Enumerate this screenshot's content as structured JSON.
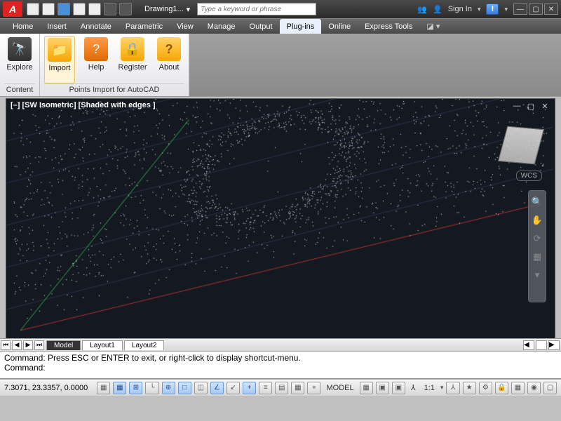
{
  "titlebar": {
    "doc_name": "Drawing1...",
    "search_placeholder": "Type a keyword or phrase",
    "signin": "Sign In"
  },
  "menu": {
    "items": [
      "Home",
      "Insert",
      "Annotate",
      "Parametric",
      "View",
      "Manage",
      "Output",
      "Plug-ins",
      "Online",
      "Express Tools"
    ],
    "active_index": 7
  },
  "ribbon": {
    "panels": [
      {
        "name": "Content",
        "buttons": [
          {
            "label": "Explore",
            "icon": "binoc"
          }
        ]
      },
      {
        "name": "Points Import for AutoCAD",
        "buttons": [
          {
            "label": "Import",
            "icon": "folder",
            "selected": true
          },
          {
            "label": "Help",
            "icon": "helpq"
          },
          {
            "label": "Register",
            "icon": "lock"
          },
          {
            "label": "About",
            "icon": "about"
          }
        ]
      }
    ]
  },
  "viewport": {
    "title": "[–] [SW Isometric] [Shaded with edges ]",
    "wcs": "WCS"
  },
  "tabs": {
    "items": [
      "Model",
      "Layout1",
      "Layout2"
    ],
    "active_index": 0
  },
  "cmd": {
    "line1": "Command:  Press ESC or ENTER to exit, or right-click to display shortcut-menu.",
    "line2": "Command:"
  },
  "status": {
    "coords": "7.3071, 23.3357, 0.0000",
    "model": "MODEL",
    "scale": "1:1"
  }
}
